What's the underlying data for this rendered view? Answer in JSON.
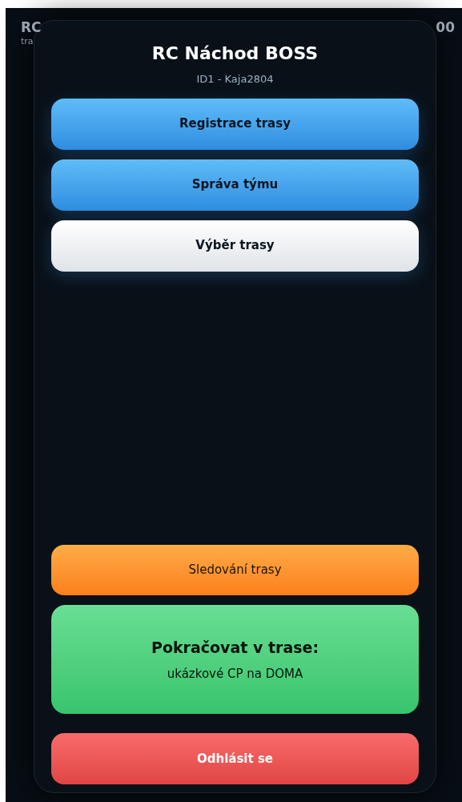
{
  "background": {
    "title": "RC",
    "route": "tra",
    "timer": "00"
  },
  "modal": {
    "title": "RC Náchod BOSS",
    "subtitle": "ID1 - Kaja2804",
    "top_buttons": [
      {
        "label": "Registrace trasy",
        "kind": "blue"
      },
      {
        "label": "Správa týmu",
        "kind": "blue"
      },
      {
        "label": "Výběr trasy",
        "kind": "white"
      }
    ],
    "track_button": {
      "label": "Sledování trasy",
      "kind": "orange"
    },
    "continue": {
      "heading": "Pokračovat v trase:",
      "route": "ukázkové CP na DOMA"
    },
    "logout": "Odhlásit se"
  }
}
